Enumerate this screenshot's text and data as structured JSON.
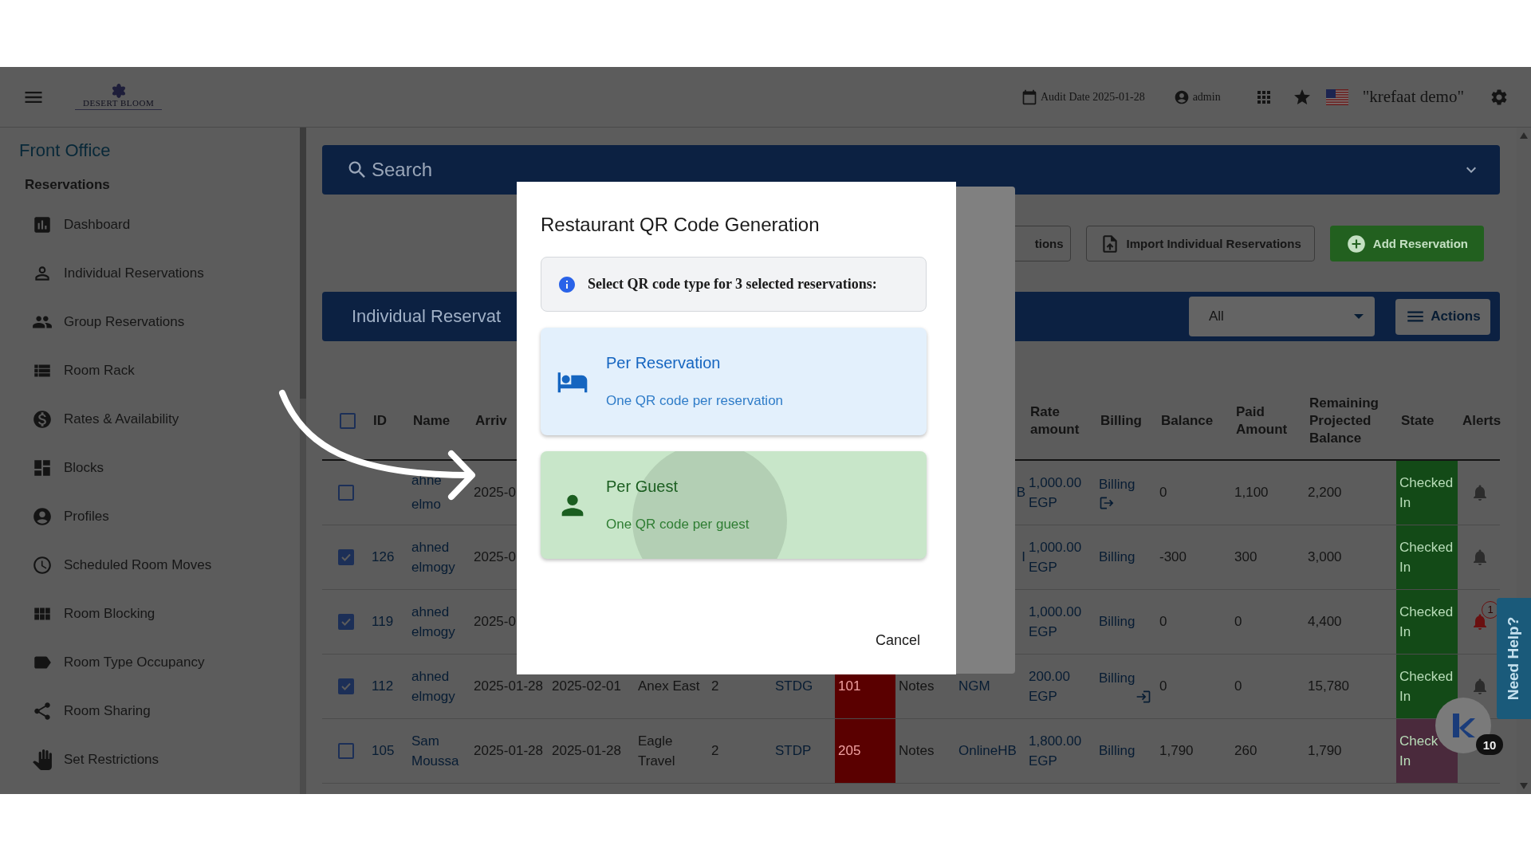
{
  "header": {
    "logo_text": "DESERT BLOOM",
    "audit_date": "Audit Date 2025-01-28",
    "user": "admin",
    "profile": "\"krefaat demo\""
  },
  "sidebar": {
    "section": "Front Office",
    "group": "Reservations",
    "items": [
      {
        "label": "Dashboard"
      },
      {
        "label": "Individual Reservations"
      },
      {
        "label": "Group Reservations"
      },
      {
        "label": "Room Rack"
      },
      {
        "label": "Rates & Availability"
      },
      {
        "label": "Blocks"
      },
      {
        "label": "Profiles"
      },
      {
        "label": "Scheduled Room Moves"
      },
      {
        "label": "Room Blocking"
      },
      {
        "label": "Room Type Occupancy"
      },
      {
        "label": "Room Sharing"
      },
      {
        "label": "Set Restrictions"
      }
    ]
  },
  "search": {
    "placeholder": "Search"
  },
  "toolbar": {
    "buttons": [
      {
        "label": "tions",
        "kind": "outline"
      },
      {
        "label": "Import Individual Reservations",
        "kind": "import"
      },
      {
        "label": "Add Reservation",
        "kind": "add"
      }
    ]
  },
  "list_bar": {
    "title": "Individual Reservat",
    "filter": "All",
    "actions": "Actions"
  },
  "table": {
    "select_all_checked": false,
    "header": {
      "id": "ID",
      "name": "Name",
      "arrival": "Arriv",
      "rate_amount": "Rate amount",
      "billing": "Billing",
      "balance": "Balance",
      "paid_amount": "Paid Amount",
      "remaining_projected_balance": "Remaining Projected Balance",
      "state": "State",
      "alerts": "Alerts"
    },
    "rows": [
      {
        "checked": false,
        "name": "ahne elmo",
        "arrival": "2025-0",
        "column_11": "B",
        "rate_amount": "1,000.00 EGP",
        "billing": {
          "label": "Billing",
          "kind": "checkout"
        },
        "balance": "0",
        "paid_amount": "1,100",
        "remaining_projected_balance": "2,200",
        "state": {
          "label": "Checked In",
          "color": "#134a17"
        },
        "bell_shown": true
      },
      {
        "checked": true,
        "id": "126",
        "name": "ahned elmogy",
        "arrival": "2025-0",
        "column_11": "I",
        "rate_amount": "1,000.00 EGP",
        "billing": {
          "label": "Billing",
          "kind": "plain"
        },
        "balance": "-300",
        "paid_amount": "300",
        "remaining_projected_balance": "3,000",
        "state": {
          "label": "Checked In",
          "color": "#134a17"
        },
        "bell_shown": true
      },
      {
        "checked": true,
        "id": "119",
        "name": "ahned elmogy",
        "arrival": "2025-0",
        "rate_amount": "1,000.00 EGP",
        "billing": {
          "label": "Billing",
          "kind": "plain"
        },
        "balance": "0",
        "paid_amount": "0",
        "remaining_projected_balance": "4,400",
        "state": {
          "label": "Checked In",
          "color": "#134a17"
        },
        "bell_shown": true,
        "alert_count": "1"
      },
      {
        "checked": true,
        "id": "112",
        "name": "ahned elmogy",
        "arrival": "2025-01-28",
        "column_5": "2025-02-01",
        "column_6": "Anex East",
        "column_7": "2",
        "column_8": "STDG",
        "column_9": {
          "label": "101",
          "color": "#5a0000"
        },
        "column_10": "Notes",
        "column_11": "NGM",
        "rate_amount": "200.00 EGP",
        "billing": {
          "label": "Billing",
          "kind": "checkin"
        },
        "balance": "0",
        "paid_amount": "0",
        "remaining_projected_balance": "15,780",
        "state": {
          "label": "Checked In",
          "color": "#134a17"
        },
        "bell_shown": true
      },
      {
        "checked": false,
        "id": "105",
        "name": "Sam Moussa",
        "arrival": "2025-01-28",
        "column_5": "2025-01-28",
        "column_6": "Eagle Travel",
        "column_7": "2",
        "column_8": "STDP",
        "column_9": {
          "label": "205",
          "color": "#5a0000"
        },
        "column_10": "Notes",
        "column_11": "OnlineHB",
        "rate_amount": "1,800.00 EGP",
        "billing": {
          "label": "Billing",
          "kind": "plain"
        },
        "balance": "1,790",
        "paid_amount": "260",
        "remaining_projected_balance": "1,790",
        "state": {
          "label": "Check In",
          "color": "#4a2a3c"
        },
        "bell_shown": false
      }
    ]
  },
  "help_tab": "Need Help?",
  "chat": {
    "badge": "10"
  },
  "dialog": {
    "title": "Restaurant QR Code Generation",
    "info": "Select QR code type for 3 selected reservations:",
    "options": [
      {
        "kind": "reservation",
        "title": "Per Reservation",
        "subtitle": "One QR code per reservation",
        "selected": false
      },
      {
        "kind": "guest",
        "title": "Per Guest",
        "subtitle": "One QR code per guest",
        "selected": true
      }
    ],
    "cancel": "Cancel"
  }
}
